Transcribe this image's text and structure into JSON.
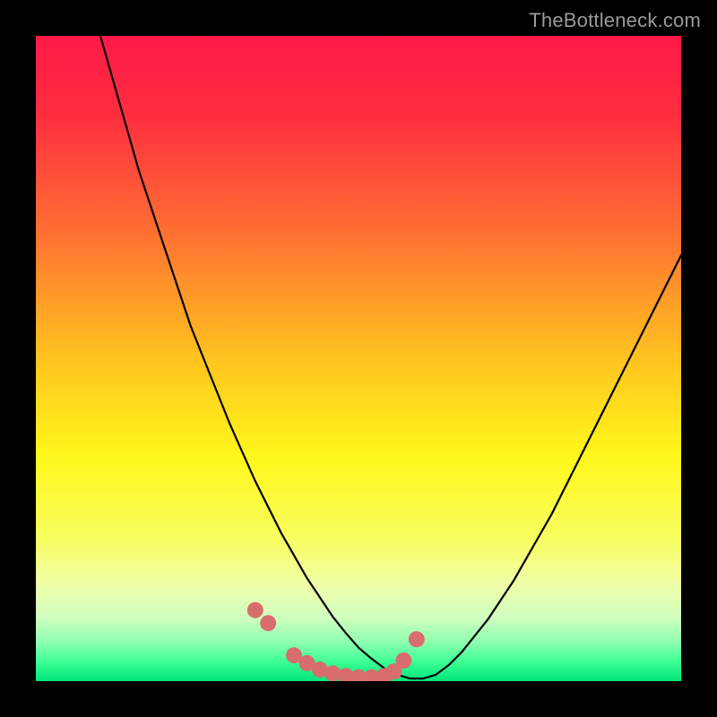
{
  "watermark": {
    "text": "TheBottleneck.com"
  },
  "chart_data": {
    "type": "line",
    "title": "",
    "xlabel": "",
    "ylabel": "",
    "xlim": [
      0,
      100
    ],
    "ylim": [
      0,
      100
    ],
    "grid": false,
    "curve": {
      "x": [
        10,
        12,
        14,
        16,
        18,
        20,
        22,
        24,
        26,
        28,
        30,
        32,
        34,
        36,
        38,
        40,
        42,
        44,
        46,
        48,
        50,
        52,
        54,
        56,
        58,
        60,
        62,
        64,
        66,
        68,
        70,
        72,
        74,
        76,
        78,
        80,
        82,
        84,
        86,
        88,
        90,
        92,
        94,
        96,
        98,
        100
      ],
      "y": [
        100,
        93,
        86,
        79,
        73,
        67,
        61,
        55,
        50,
        45,
        40,
        35.5,
        31,
        27,
        23,
        19.5,
        16,
        13,
        10,
        7.5,
        5.2,
        3.5,
        2.0,
        1.0,
        0.4,
        0.4,
        1.0,
        2.5,
        4.5,
        7.0,
        9.5,
        12.5,
        15.5,
        19,
        22.5,
        26,
        30,
        34,
        38,
        42,
        46,
        50,
        54,
        58,
        62,
        66
      ]
    },
    "markers": {
      "x": [
        34,
        36,
        40,
        42,
        44,
        46,
        48,
        50,
        52,
        54,
        55.5,
        57,
        59
      ],
      "y": [
        11,
        9,
        4,
        2.8,
        1.8,
        1.2,
        0.8,
        0.6,
        0.6,
        0.8,
        1.5,
        3.2,
        6.5
      ],
      "color": "#d86d6d",
      "radius_px": 9
    },
    "gradient_stops": [
      {
        "offset": 0.0,
        "color": "#ff1a47"
      },
      {
        "offset": 0.12,
        "color": "#ff2d3f"
      },
      {
        "offset": 0.3,
        "color": "#ff6e33"
      },
      {
        "offset": 0.5,
        "color": "#ffc31f"
      },
      {
        "offset": 0.65,
        "color": "#fff71a"
      },
      {
        "offset": 0.78,
        "color": "#f8ff60"
      },
      {
        "offset": 0.85,
        "color": "#f0ffa8"
      },
      {
        "offset": 0.9,
        "color": "#d2ffc0"
      },
      {
        "offset": 0.94,
        "color": "#8dffb0"
      },
      {
        "offset": 0.97,
        "color": "#3cff93"
      },
      {
        "offset": 1.0,
        "color": "#00e57a"
      }
    ]
  }
}
